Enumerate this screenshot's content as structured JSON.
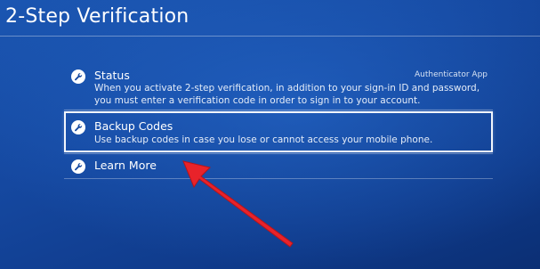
{
  "header": {
    "title": "2-Step Verification"
  },
  "menu": {
    "items": [
      {
        "label": "Status",
        "value": "Authenticator App",
        "description": "When you activate 2-step verification, in addition to your sign-in ID and password, you must enter a verification code in order to sign in to your account.",
        "icon": "wrench-icon"
      },
      {
        "label": "Backup Codes",
        "description": "Use backup codes in case you lose or cannot access your mobile phone.",
        "icon": "wrench-icon",
        "selected": true
      },
      {
        "label": "Learn More",
        "icon": "wrench-icon"
      }
    ]
  },
  "annotation": {
    "arrow_color": "#e8232a",
    "points_to": "backup-codes-item"
  },
  "colors": {
    "background": "#1548a0",
    "text": "#ffffff",
    "selection_border": "#f2f6fc"
  }
}
